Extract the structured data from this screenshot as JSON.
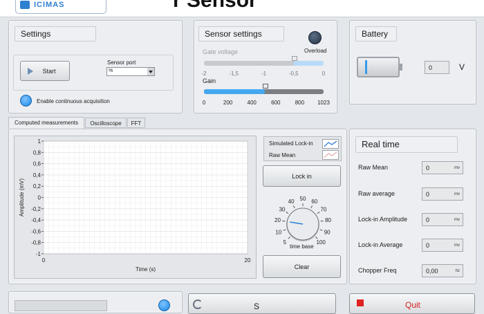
{
  "header": {
    "title": "r Sensor",
    "logo_label": "ICIMAS"
  },
  "settings": {
    "title": "Settings",
    "start_label": "Start",
    "sensor_port_label": "Sensor port",
    "sensor_port_value": "%",
    "continuous_label": "Enable continuous acquisition"
  },
  "sensor_settings": {
    "title": "Sensor settings",
    "overload_label": "Overload",
    "gate_label": "Gate voltage",
    "gate_ticks": [
      "-2",
      "-1,5",
      "-1",
      "-0,5",
      "0"
    ],
    "gate_value": -0.5,
    "gain_label": "Gain",
    "gain_ticks": [
      "0",
      "200",
      "400",
      "600",
      "800",
      "1023"
    ],
    "gain_value": 520
  },
  "battery": {
    "title": "Battery",
    "value": "0",
    "unit": "V"
  },
  "tabs": [
    "Computed measurements",
    "Oscilloscope",
    "FFT"
  ],
  "chart_legend": {
    "simulated": "Simulated Lock-in",
    "raw": "Raw Mean"
  },
  "buttons": {
    "lock_in": "Lock in",
    "clear": "Clear"
  },
  "knob": {
    "label": "time base",
    "ticks": [
      "5",
      "10",
      "20",
      "30",
      "40",
      "50",
      "60",
      "70",
      "80",
      "90",
      "100"
    ],
    "value": 20
  },
  "realtime": {
    "title": "Real time",
    "rows": [
      {
        "label": "Raw Mean",
        "value": "0",
        "unit": "mv"
      },
      {
        "label": "Raw average",
        "value": "0",
        "unit": "mv"
      },
      {
        "label": "Lock-in Amplitude",
        "value": "0",
        "unit": "mv"
      },
      {
        "label": "Lock-in Average",
        "value": "0",
        "unit": "mv"
      },
      {
        "label": "Chopper Freq",
        "value": "0,00",
        "unit": "hz"
      }
    ]
  },
  "bottom": {
    "mid_label": "S",
    "right_label": "Quit"
  },
  "chart_data": {
    "type": "line",
    "xlabel": "Time (s)",
    "ylabel": "Amplitude (mV)",
    "xlim": [
      0,
      20
    ],
    "ylim": [
      -1,
      1
    ],
    "x_ticks": [
      "0",
      "20"
    ],
    "y_ticks": [
      "1",
      "0,8",
      "0,6",
      "0,4",
      "0,2",
      "0",
      "-0,2",
      "-0,4",
      "-0,6",
      "-0,8",
      "-1"
    ],
    "grid": true,
    "series": []
  }
}
